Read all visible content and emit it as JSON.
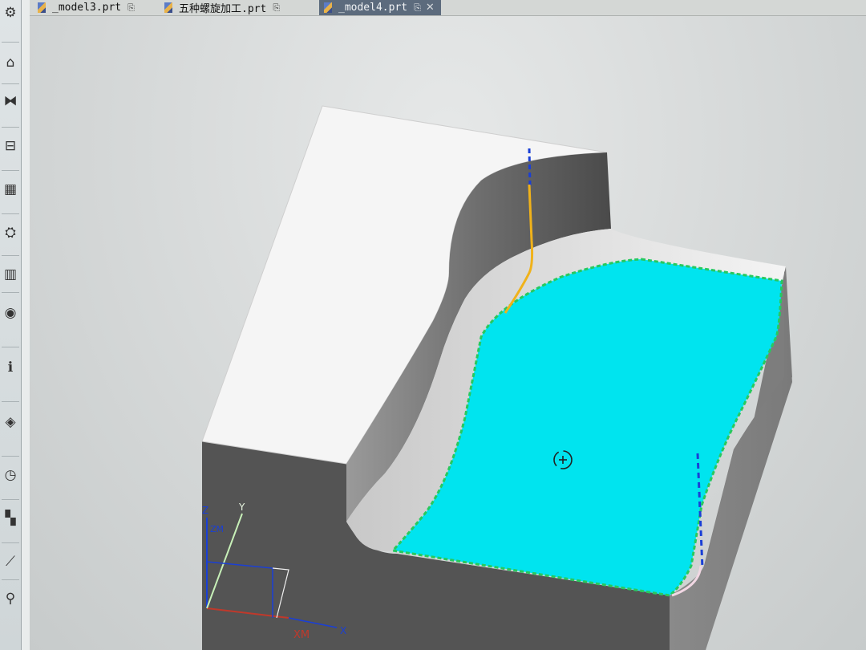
{
  "tabs": [
    {
      "label": "_model3.prt",
      "active": false
    },
    {
      "label": "五种螺旋加工.prt",
      "active": false
    },
    {
      "label": "_model4.prt",
      "active": true
    }
  ],
  "tab_close_glyph": "✕",
  "toolbar": [
    {
      "icon": "settings-gear-icon",
      "glyph": "⚙"
    },
    {
      "icon": "assembly-navigator-icon",
      "glyph": "⌂"
    },
    {
      "icon": "constraint-navigator-icon",
      "glyph": "⧓"
    },
    {
      "icon": "part-navigator-icon",
      "glyph": "⊟"
    },
    {
      "icon": "reuse-library-icon",
      "glyph": "▦"
    },
    {
      "icon": "machine-tool-icon",
      "glyph": "⛭"
    },
    {
      "icon": "books-library-icon",
      "glyph": "▥"
    },
    {
      "icon": "eye-visibility-icon",
      "glyph": "◉"
    },
    {
      "icon": "information-icon",
      "glyph": "ℹ"
    },
    {
      "icon": "web-browser-icon",
      "glyph": "◈"
    },
    {
      "icon": "history-clock-icon",
      "glyph": "◷"
    },
    {
      "icon": "color-palette-icon",
      "glyph": "▚"
    },
    {
      "icon": "measure-tool-icon",
      "glyph": "⟋"
    },
    {
      "icon": "roles-icon",
      "glyph": "⚲"
    }
  ],
  "triad": {
    "z": "Z",
    "y": "Y",
    "x": "X",
    "zm": "ZM",
    "xm": "XM"
  },
  "colors": {
    "selection_fill": "#00e6f0",
    "selection_edge": "#2fd36a",
    "toolpath": "#f0b21a",
    "tool_axis": "#1a3fd6",
    "block_top": "#f3f3f3",
    "block_side": "#5a5a5a"
  }
}
